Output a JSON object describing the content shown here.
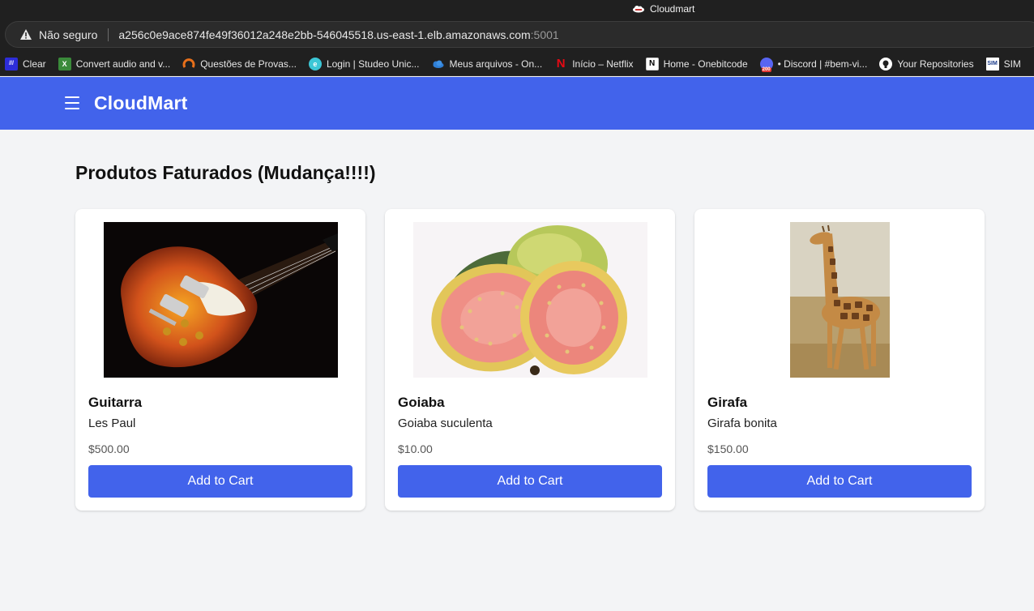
{
  "browser": {
    "tab_title": "Cloudmart",
    "security_label": "Não seguro",
    "url": "a256c0e9ace874fe49f36012a248e2bb-546045518.us-east-1.elb.amazonaws.com",
    "url_port": ":5001",
    "bookmarks": [
      {
        "label": "Clear",
        "icon": "clear-icon",
        "color": "#2d2dd8"
      },
      {
        "label": "Convert audio and v...",
        "icon": "convert-icon",
        "color": "#3a8a3a"
      },
      {
        "label": "Questões de Provas...",
        "icon": "questoes-icon",
        "color": "#e8701a"
      },
      {
        "label": "Login | Studeo Unic...",
        "icon": "studeo-icon",
        "color": "#3cc7d6"
      },
      {
        "label": "Meus arquivos - On...",
        "icon": "onedrive-icon",
        "color": "#2f7fd6"
      },
      {
        "label": "Início – Netflix",
        "icon": "netflix-icon",
        "color": "#e50914"
      },
      {
        "label": "Home - Onebitcode",
        "icon": "notion-icon",
        "color": "#ffffff"
      },
      {
        "label": "• Discord | #bem-vi...",
        "icon": "discord-icon",
        "color": "#5865f2"
      },
      {
        "label": "Your Repositories",
        "icon": "github-icon",
        "color": "#ffffff"
      },
      {
        "label": "SIM",
        "icon": "sim-icon",
        "color": "#ffffff"
      }
    ]
  },
  "header": {
    "brand": "CloudMart",
    "accent_color": "#4263eb"
  },
  "main": {
    "title": "Produtos Faturados (Mudança!!!!)",
    "products": [
      {
        "name": "Guitarra",
        "description": "Les Paul",
        "price": "$500.00",
        "button": "Add to Cart",
        "image": "electric-guitar"
      },
      {
        "name": "Goiaba",
        "description": "Goiaba suculenta",
        "price": "$10.00",
        "button": "Add to Cart",
        "image": "guava-fruit"
      },
      {
        "name": "Girafa",
        "description": "Girafa bonita",
        "price": "$150.00",
        "button": "Add to Cart",
        "image": "giraffe"
      }
    ]
  }
}
